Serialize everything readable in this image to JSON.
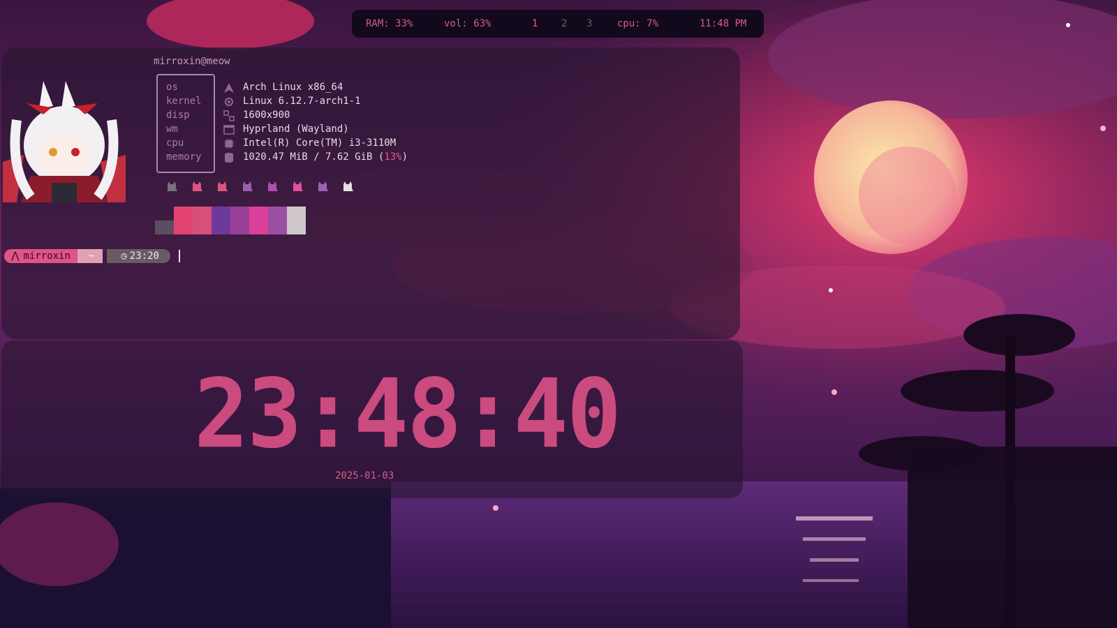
{
  "topbar": {
    "ram": "RAM: 33%",
    "volume": "vol: 63%",
    "workspaces": [
      "1",
      "2",
      "3"
    ],
    "active_workspace": "1",
    "cpu": "cpu: 7%",
    "time": "11:48 PM"
  },
  "terminal": {
    "title": "mirroxin@meow",
    "info": [
      {
        "key": "os",
        "value": "Arch Linux x86_64",
        "icon": "arch-icon"
      },
      {
        "key": "kernel",
        "value": "Linux 6.12.7-arch1-1",
        "icon": "gear-icon"
      },
      {
        "key": "disp",
        "value": "1600x900",
        "icon": "display-icon"
      },
      {
        "key": "wm",
        "value": "Hyprland (Wayland)",
        "icon": "window-icon"
      },
      {
        "key": "cpu",
        "value": "Intel(R) Core(TM) i3-3110M",
        "icon": "chip-icon"
      },
      {
        "key": "memory",
        "value": "1020.47 MiB / 7.62 GiB (",
        "value_pct": "13%",
        "value_end": ")",
        "icon": "database-icon"
      }
    ],
    "cat_colors": [
      "#7c6f7e",
      "#e2567e",
      "#d9557b",
      "#9b5fb0",
      "#b14fb0",
      "#e14ea3",
      "#9c62b8",
      "#e6e0e6"
    ],
    "swatch_colors": [
      "#5a4e60",
      "#e2426f",
      "#d8507a",
      "#6d3a9c",
      "#9a3f98",
      "#db3f9a",
      "#9b4fa4",
      "#cfc7cc"
    ],
    "prompt": {
      "user": "mirroxin",
      "dir": "~",
      "time": "23:20"
    }
  },
  "clock": {
    "time": "23:48:40",
    "date": "2025-01-03"
  },
  "colors": {
    "accent": "#cb4b7f",
    "pink": "#e15485"
  }
}
